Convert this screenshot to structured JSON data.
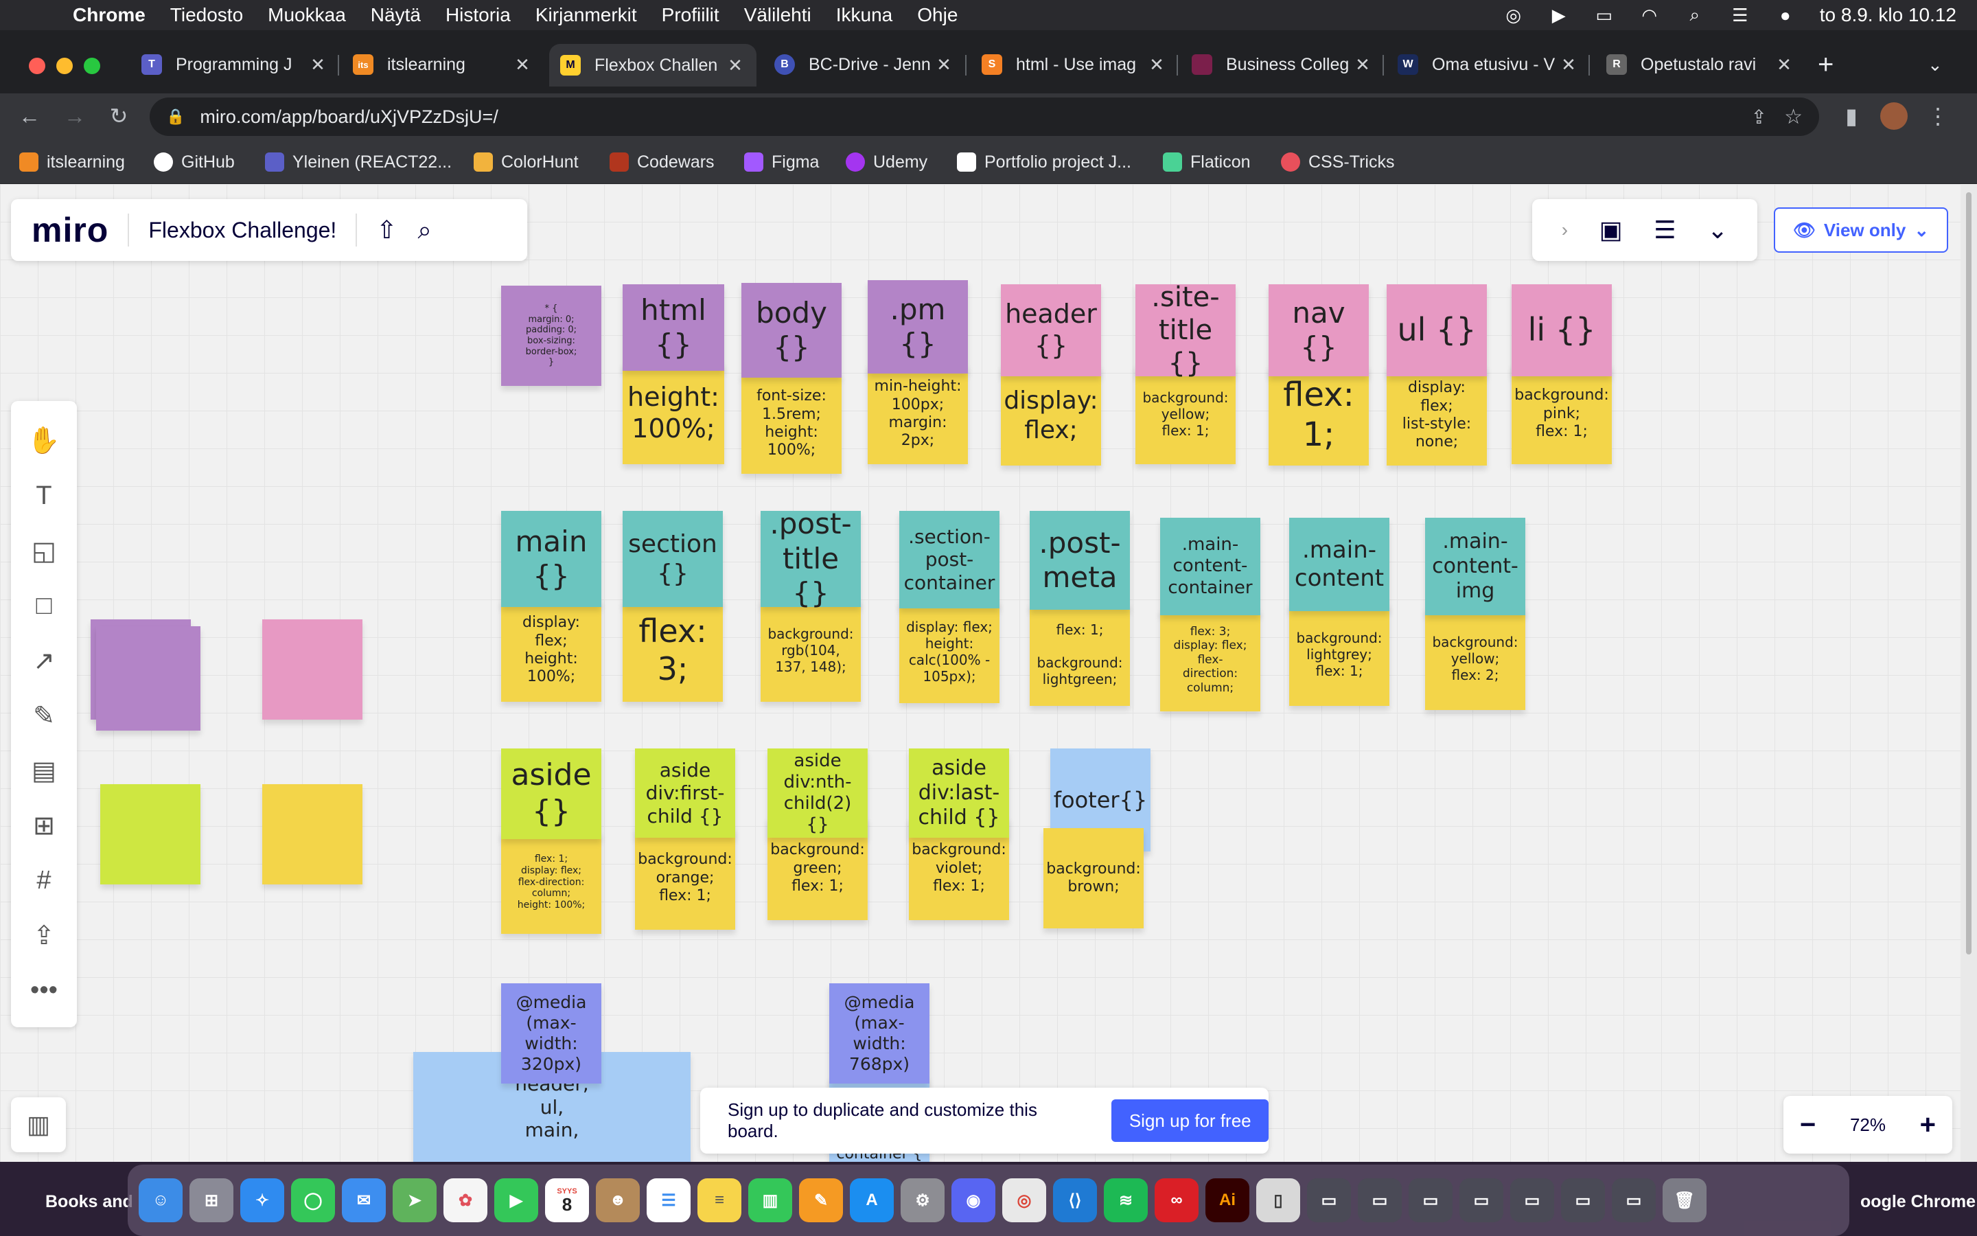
{
  "menubar": {
    "app": "Chrome",
    "items": [
      "Tiedosto",
      "Muokkaa",
      "Näytä",
      "Historia",
      "Kirjanmerkit",
      "Profiilit",
      "Välilehti",
      "Ikkuna",
      "Ohje"
    ],
    "clock": "to 8.9. klo 10.12"
  },
  "tabs": [
    {
      "title": "Programming J",
      "fav": "T",
      "color": "#5b5fc7"
    },
    {
      "title": "itslearning",
      "fav": "its",
      "color": "#f08a24"
    },
    {
      "title": "Flexbox Challen",
      "fav": "M",
      "color": "#ffd02f"
    },
    {
      "title": "BC-Drive - Jenn",
      "fav": "B",
      "color": "#3f51b5"
    },
    {
      "title": "html - Use imag",
      "fav": "S",
      "color": "#f48024"
    },
    {
      "title": "Business Colleg",
      "fav": "",
      "color": "#7b1f4b"
    },
    {
      "title": "Oma etusivu - V",
      "fav": "W",
      "color": "#1a2a5a"
    },
    {
      "title": "Opetustalo ravi",
      "fav": "R",
      "color": "#666666"
    }
  ],
  "omnibox": {
    "url": "miro.com/app/board/uXjVPZzDsjU=/"
  },
  "bookmarks": [
    {
      "label": "itslearning",
      "color": "#f08a24"
    },
    {
      "label": "GitHub",
      "color": "#ffffff"
    },
    {
      "label": "Yleinen (REACT22...",
      "color": "#5b5fc7"
    },
    {
      "label": "ColorHunt",
      "color": "#f2b33d"
    },
    {
      "label": "Codewars",
      "color": "#b1361e"
    },
    {
      "label": "Figma",
      "color": "#a259ff"
    },
    {
      "label": "Udemy",
      "color": "#a435f0"
    },
    {
      "label": "Portfolio project J...",
      "color": "#ffffff"
    },
    {
      "label": "Flaticon",
      "color": "#4ad295"
    },
    {
      "label": "CSS-Tricks",
      "color": "#e8505b"
    }
  ],
  "miro": {
    "logo": "miro",
    "board_name": "Flexbox Challenge!",
    "view_only": "View only",
    "zoom": "72%",
    "signup_text": "Sign up to duplicate and customize this board.",
    "signup_button": "Sign up for free"
  },
  "notes": {
    "universal": "* {\nmargin: 0;\npadding: 0;\nbox-sizing:\nborder-box;\n}",
    "html_sel": "html\n{}",
    "html_rule": "height:\n100%;",
    "body_sel": "body\n{}",
    "body_rule": "font-size:\n1.5rem;\nheight:\n100%;",
    "pm_sel": ".pm\n{}",
    "pm_rule": "min-height:\n100px;\nmargin:\n2px;",
    "header_sel": "header\n{}",
    "header_rule": "display:\nflex;",
    "sitetitle_sel": ".site-\ntitle {}",
    "sitetitle_rule": "background:\nyellow;\nflex: 1;",
    "nav_sel": "nav {}",
    "nav_rule": "flex:\n1;",
    "ul_sel": "ul {}",
    "ul_rule": "display:\nflex;\nlist-style:\nnone;",
    "li_sel": "li {}",
    "li_rule": "background:\npink;\nflex: 1;",
    "main_sel": "main\n{}",
    "main_rule": "display:\nflex;\nheight:\n100%;",
    "section_sel": "section\n{}",
    "section_rule": "flex:\n3;",
    "posttitle_sel": ".post-\ntitle {}",
    "posttitle_rule": "background:\nrgb(104,\n137, 148);",
    "spc_sel": ".section-\npost-\ncontainer",
    "spc_rule": "display: flex;\nheight:\ncalc(100% -\n105px);",
    "postmeta_sel": ".post-\nmeta",
    "postmeta_rule": "flex: 1;\n\nbackground:\nlightgreen;",
    "mcc_sel": ".main-\ncontent-\ncontainer",
    "mcc_rule": "flex: 3;\ndisplay: flex;\nflex-\ndirection:\ncolumn;",
    "mc_sel": ".main-\ncontent",
    "mc_rule": "background:\nlightgrey;\nflex: 1;",
    "mci_sel": ".main-\ncontent-\nimg",
    "mci_rule": "background:\nyellow;\nflex: 2;",
    "aside_sel": "aside\n{}",
    "aside_rule": "flex: 1;\ndisplay: flex;\nflex-direction:\ncolumn;\nheight: 100%;",
    "aside1_sel": "aside\ndiv:first-\nchild {}",
    "aside1_rule": "background:\norange;\nflex: 1;",
    "aside2_sel": "aside\ndiv:nth-\nchild(2) {}",
    "aside2_rule": "background:\ngreen;\nflex: 1;",
    "aside3_sel": "aside\ndiv:last-\nchild {}",
    "aside3_rule": "background:\nviolet;\nflex: 1;",
    "footer_sel": "footer{}",
    "footer_rule": "background:\nbrown;",
    "media320": "@media\n(max-width:\n320px)",
    "media768": "@media\n(max-width:\n768px)",
    "media320_body": "header,\nul,\nmain,",
    "media768_body": "container {"
  },
  "dock": {
    "left_label": "Books and",
    "right_label": "oogle Chrome",
    "calendar_month": "SYYS",
    "calendar_day": "8"
  }
}
